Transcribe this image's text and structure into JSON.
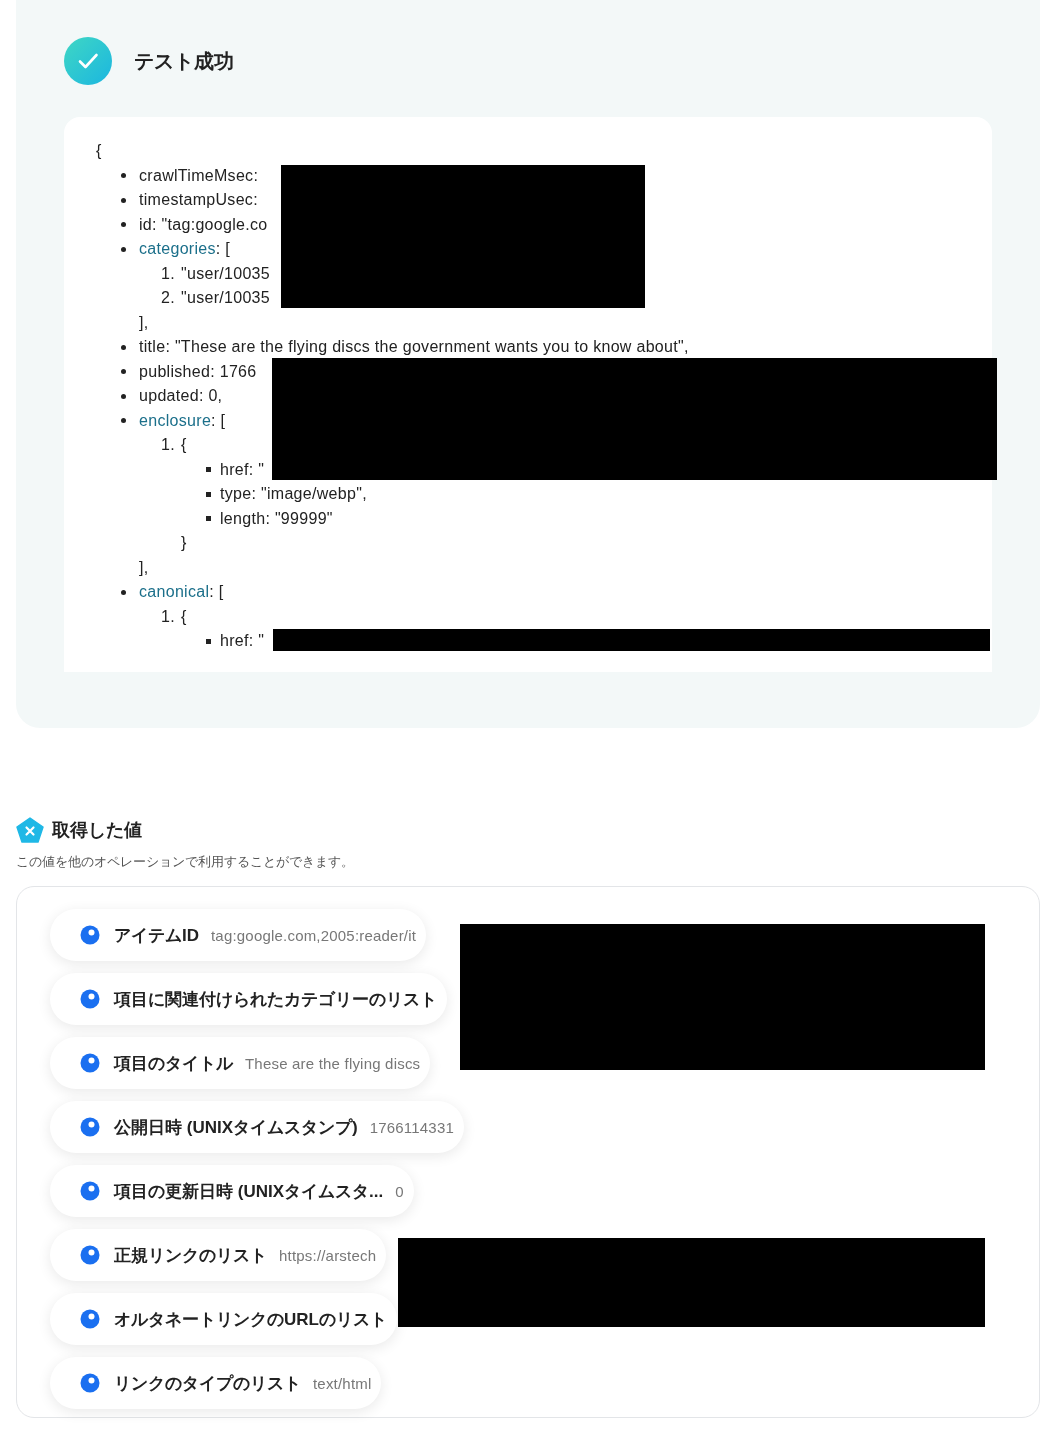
{
  "result": {
    "title": "テスト成功",
    "open": "{",
    "items": [
      {
        "text": "crawlTimeMsec:"
      },
      {
        "text": "timestampUsec:"
      },
      {
        "text": "id: \"tag:google.co"
      },
      {
        "key": "categories",
        "text": ": [",
        "close": "],",
        "children": [
          {
            "marker": "1.",
            "text": "\"user/10035"
          },
          {
            "marker": "2.",
            "text": "\"user/10035"
          }
        ]
      },
      {
        "text": "title: \"These are the flying discs the government wants you to know about\","
      },
      {
        "text": "published: 1766"
      },
      {
        "text": "updated: 0,"
      },
      {
        "key": "enclosure",
        "text": ": [",
        "close": "],",
        "children": [
          {
            "marker": "1.",
            "text": "{",
            "close": "}",
            "children": [
              {
                "text": "href: \""
              },
              {
                "text": "type: \"image/webp\","
              },
              {
                "text": "length: \"99999\""
              }
            ]
          }
        ]
      },
      {
        "key": "canonical",
        "text": ": [",
        "children": [
          {
            "marker": "1.",
            "text": "{",
            "children": [
              {
                "text": "href: \""
              }
            ]
          }
        ]
      }
    ]
  },
  "values": {
    "title": "取得した値",
    "description": "この値を他のオペレーションで利用することができます。",
    "rows": [
      {
        "label": "アイテムID",
        "value": "tag:google.com,2005:reader/it"
      },
      {
        "label": "項目に関連付けられたカテゴリーのリスト"
      },
      {
        "label": "項目のタイトル",
        "value": "These are the flying discs"
      },
      {
        "label": "公開日時 (UNIXタイムスタンプ)",
        "value": "1766114331"
      },
      {
        "label": "項目の更新日時 (UNIXタイムスタ...",
        "value": "0"
      },
      {
        "label": "正規リンクのリスト",
        "value": "https://arstech"
      },
      {
        "label": "オルタネートリンクのURLのリスト"
      },
      {
        "label": "リンクのタイプのリスト",
        "value": "text/html"
      }
    ]
  }
}
